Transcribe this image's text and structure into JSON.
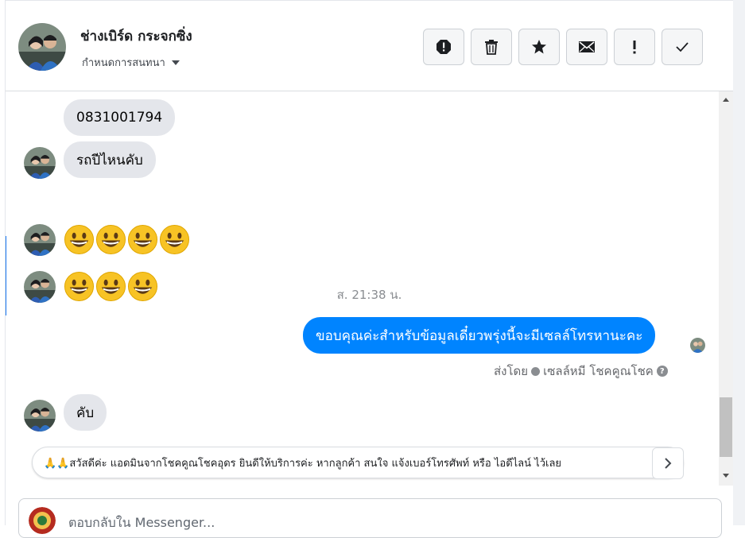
{
  "header": {
    "contact_name": "ช่างเบิร์ด กระจกซิ่ง",
    "assign_label": "กำหนดการสนทนา",
    "actions": [
      {
        "icon": "alert-octagon-icon",
        "name": "spam-button"
      },
      {
        "icon": "trash-icon",
        "name": "delete-button"
      },
      {
        "icon": "star-icon",
        "name": "star-button"
      },
      {
        "icon": "envelope-icon",
        "name": "mark-unread-button"
      },
      {
        "icon": "exclamation-icon",
        "name": "follow-up-button"
      },
      {
        "icon": "checkmark-icon",
        "name": "done-button"
      }
    ]
  },
  "messages": {
    "incoming_phone": "0831001794",
    "incoming_question": "รถปีไหนคับ",
    "timestamp": "ส. 21:38 น.",
    "emoji_row_1": [
      "😀",
      "😀",
      "😀",
      "😀"
    ],
    "emoji_row_2": [
      "😀",
      "😀",
      "😀"
    ],
    "outgoing_text": "ขอบคุณค่ะสำหรับข้อมูลเดี๋ยวพรุ่งนี้จะมีเซลล์โทรหานะคะ",
    "sent_by_prefix": "ส่งโดย",
    "sent_by_name": "เซลล์หมี โชคคูณโชค",
    "incoming_last": "คับ"
  },
  "quick_reply": {
    "text": "🙏🙏สวัสดีค่ะ แอดมินจากโชคคูณโชคอุดร ยินดีให้บริการค่ะ หากลูกค้า สนใจ แจ้งเบอร์โทรศัพท์ หรือ ไอดีไลน์ ไว้เลย"
  },
  "composer": {
    "placeholder": "ตอบกลับใน Messenger..."
  },
  "colors": {
    "accent": "#0084ff",
    "incoming_bubble": "#e4e6eb",
    "muted_text": "#65676b"
  }
}
